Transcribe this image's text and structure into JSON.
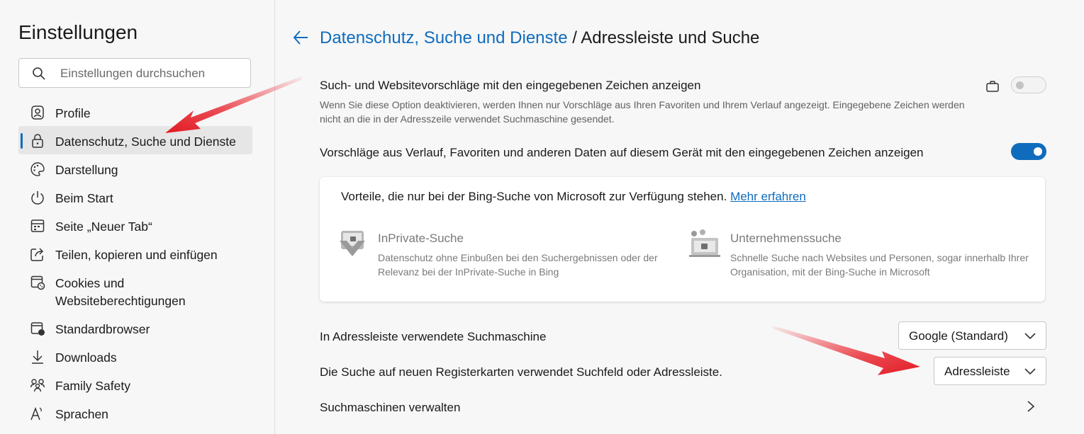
{
  "sidebar": {
    "title": "Einstellungen",
    "search_placeholder": "Einstellungen durchsuchen",
    "items": [
      {
        "label": "Profile",
        "icon": "profile-icon"
      },
      {
        "label": "Datenschutz, Suche und Dienste",
        "icon": "lock-icon",
        "active": true
      },
      {
        "label": "Darstellung",
        "icon": "palette-icon"
      },
      {
        "label": "Beim Start",
        "icon": "power-icon"
      },
      {
        "label": "Seite „Neuer Tab“",
        "icon": "new-tab-icon"
      },
      {
        "label": "Teilen, kopieren und einfügen",
        "icon": "share-icon"
      },
      {
        "label": "Cookies und",
        "label2": "Websiteberechtigungen",
        "icon": "cookies-icon"
      },
      {
        "label": "Standardbrowser",
        "icon": "browser-icon"
      },
      {
        "label": "Downloads",
        "icon": "download-icon"
      },
      {
        "label": "Family Safety",
        "icon": "family-icon"
      },
      {
        "label": "Sprachen",
        "icon": "language-icon"
      }
    ]
  },
  "header": {
    "breadcrumb_link": "Datenschutz, Suche und Dienste",
    "separator": "/",
    "page_title": "Adressleiste und Suche"
  },
  "settings": {
    "suggest_title": "Such- und Websitevorschläge mit den eingegebenen Zeichen anzeigen",
    "suggest_desc": "Wenn Sie diese Option deaktivieren, werden Ihnen nur Vorschläge aus Ihren Favoriten und Ihrem Verlauf angezeigt. Eingegebene Zeichen werden nicht an die in der Adresszeile verwendet Suchmaschine gesendet.",
    "suggest_enabled": false,
    "history_title": "Vorschläge aus Verlauf, Favoriten und anderen Daten auf diesem Gerät mit den eingegebenen Zeichen anzeigen",
    "history_enabled": true
  },
  "bing_card": {
    "heading": "Vorteile, die nur bei der Bing-Suche von Microsoft zur Verfügung stehen.",
    "more_link": "Mehr erfahren",
    "features": [
      {
        "title": "InPrivate-Suche",
        "desc": "Datenschutz ohne Einbußen bei den Suchergebnissen oder der Relevanz bei der InPrivate-Suche in Bing"
      },
      {
        "title": "Unternehmenssuche",
        "desc": "Schnelle Suche nach Websites und Personen, sogar innerhalb Ihrer Organisation, mit der Bing-Suche in Microsoft"
      }
    ]
  },
  "search_engine": {
    "label": "In Adressleiste verwendete Suchmaschine",
    "value": "Google (Standard)"
  },
  "newtab_search": {
    "label": "Die Suche auf neuen Registerkarten verwendet Suchfeld oder Adressleiste.",
    "value": "Adressleiste"
  },
  "manage": {
    "label": "Suchmaschinen verwalten"
  },
  "colors": {
    "accent": "#0f6cbd",
    "annotation_arrow": "#e8202a"
  }
}
